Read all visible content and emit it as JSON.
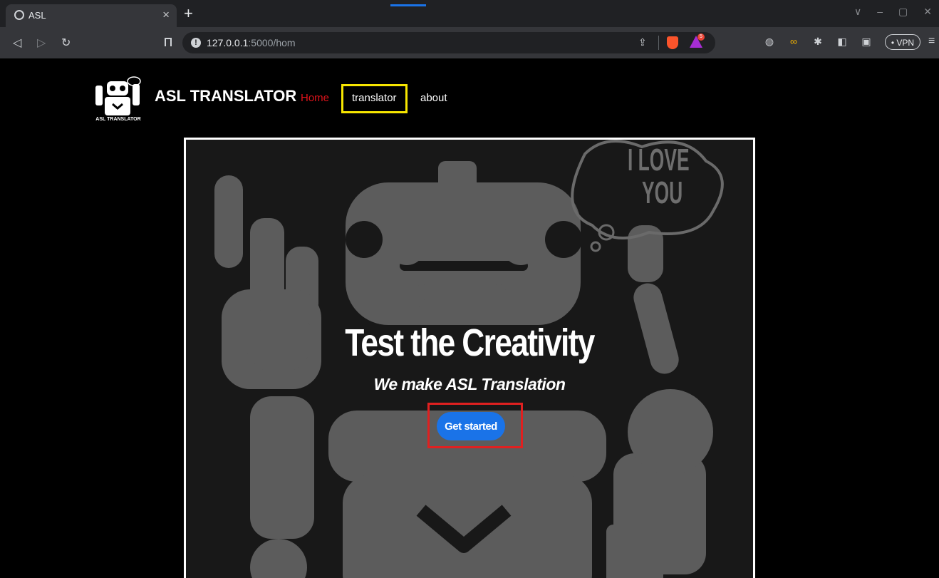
{
  "browser": {
    "tab_title": "ASL",
    "tab_close": "×",
    "new_tab": "+",
    "window_controls": [
      "∨",
      "–",
      "▢",
      "✕"
    ],
    "url_host": "127.0.0.1",
    "url_path": ":5000/hom",
    "rewards_badge": "5",
    "vpn_label": "• VPN",
    "icons": [
      "back-icon",
      "forward-icon",
      "reload-icon",
      "bookmark-icon",
      "site-info-icon",
      "share-icon",
      "brave-shields-icon",
      "brave-rewards-icon",
      "globe-icon",
      "infinity-icon",
      "extensions-icon",
      "sidebar-icon",
      "wallet-icon",
      "menu-icon"
    ]
  },
  "site": {
    "brand": "ASL TRANSLATOR",
    "logo_caption": "ASL TRANSLATOR",
    "nav": {
      "home": "Home",
      "translator": "translator",
      "about": "about"
    },
    "hero": {
      "title": "Test the Creativity",
      "subtitle": "We make ASL Translation",
      "cta": "Get started",
      "bubble_text_1": "I LOVE",
      "bubble_text_2": "YOU"
    },
    "colors": {
      "home_link": "#e0131b",
      "highlight_yellow": "#f7e600",
      "highlight_red": "#e02020",
      "cta_blue": "#1a73e8"
    }
  }
}
